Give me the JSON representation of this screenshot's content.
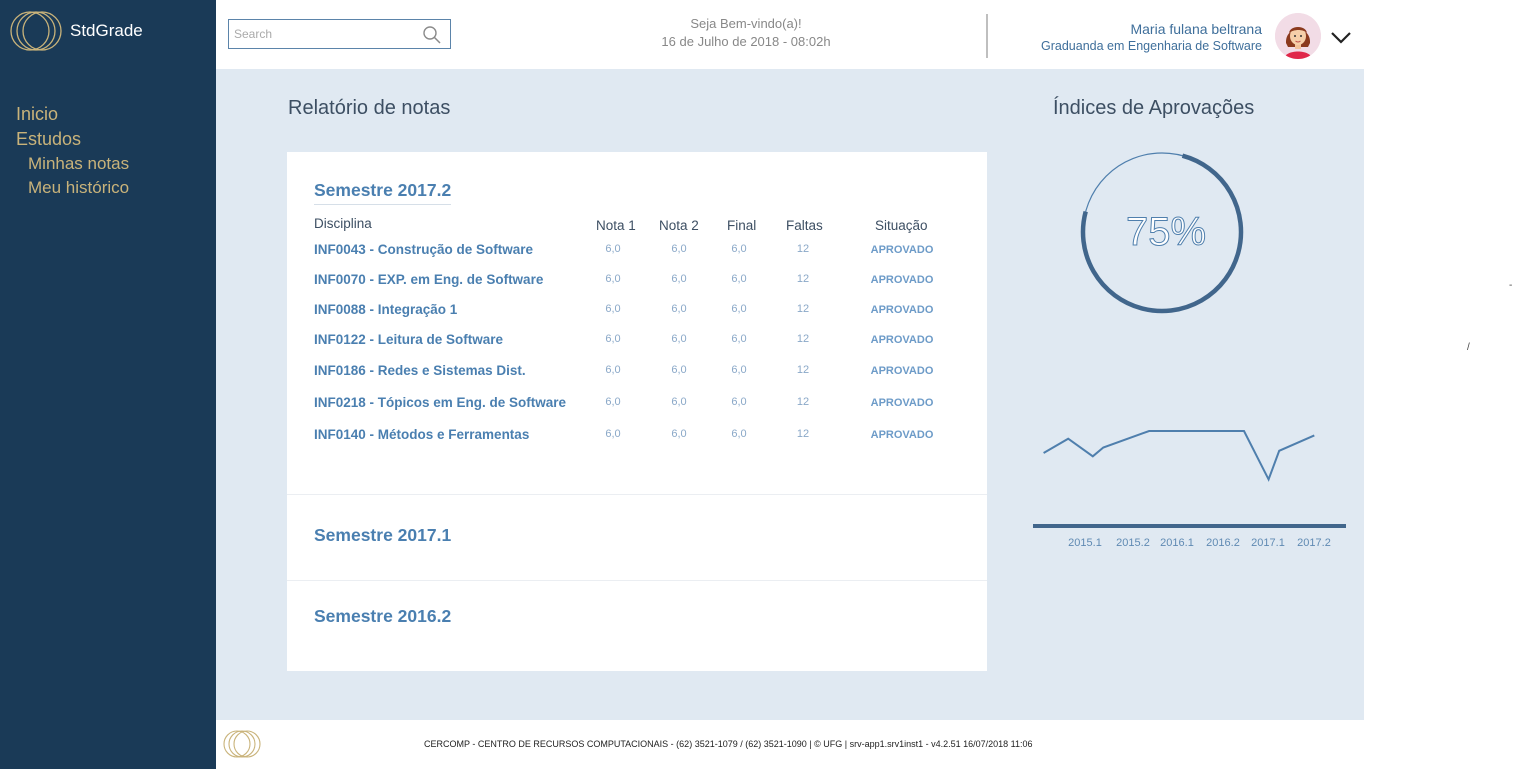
{
  "app": {
    "name": "StdGrade"
  },
  "sidebar": {
    "items": [
      {
        "label": "Inicio"
      },
      {
        "label": "Estudos"
      },
      {
        "label": "Minhas notas"
      },
      {
        "label": "Meu histórico"
      }
    ]
  },
  "header": {
    "search_placeholder": "Search",
    "welcome": "Seja Bem-vindo(a)!",
    "datetime": "16 de Julho de 2018 - 08:02h",
    "user_name": "Maria fulana beltrana",
    "user_role": "Graduanda em Engenharia de Software"
  },
  "report": {
    "title": "Relatório de notas",
    "open_semester": "Semestre 2017.2",
    "columns": {
      "disciplina": "Disciplina",
      "nota1": "Nota 1",
      "nota2": "Nota 2",
      "final": "Final",
      "faltas": "Faltas",
      "situacao": "Situação"
    },
    "rows": [
      {
        "disciplina": "INF0043 - Construção de Software",
        "nota1": "6,0",
        "nota2": "6,0",
        "final": "6,0",
        "faltas": "12",
        "situacao": "APROVADO"
      },
      {
        "disciplina": "INF0070 - EXP. em Eng. de Software",
        "nota1": "6,0",
        "nota2": "6,0",
        "final": "6,0",
        "faltas": "12",
        "situacao": "APROVADO"
      },
      {
        "disciplina": "INF0088 - Integração 1",
        "nota1": "6,0",
        "nota2": "6,0",
        "final": "6,0",
        "faltas": "12",
        "situacao": "APROVADO"
      },
      {
        "disciplina": "INF0122 - Leitura de Software",
        "nota1": "6,0",
        "nota2": "6,0",
        "final": "6,0",
        "faltas": "12",
        "situacao": "APROVADO"
      },
      {
        "disciplina": "INF0186 - Redes e Sistemas Dist.",
        "nota1": "6,0",
        "nota2": "6,0",
        "final": "6,0",
        "faltas": "12",
        "situacao": "APROVADO"
      },
      {
        "disciplina": "INF0218 - Tópicos em Eng. de Software",
        "nota1": "6,0",
        "nota2": "6,0",
        "final": "6,0",
        "faltas": "12",
        "situacao": "APROVADO"
      },
      {
        "disciplina": "INF0140 - Métodos e Ferramentas",
        "nota1": "6,0",
        "nota2": "6,0",
        "final": "6,0",
        "faltas": "12",
        "situacao": "APROVADO"
      }
    ],
    "collapsed_semesters": [
      "Semestre 2017.1",
      "Semestre 2016.2"
    ]
  },
  "indices": {
    "title": "Índices de Aprovações",
    "percent_label": "75%",
    "percent_value": 0.75
  },
  "chart_data": {
    "type": "line",
    "categories": [
      "2015.1",
      "2015.2",
      "2016.1",
      "2016.2",
      "2017.1",
      "2017.2"
    ],
    "x": [
      0.3,
      1,
      1.7,
      2,
      3.3,
      4,
      5,
      6,
      6.7,
      7,
      8
    ],
    "values": [
      60,
      73,
      57,
      65,
      80,
      80,
      80,
      80,
      36,
      62,
      76
    ],
    "xlabel": "",
    "ylabel": "",
    "ylim": [
      0,
      100
    ],
    "xlim": [
      0,
      8.9
    ],
    "color": "#4f7fad",
    "grid": false,
    "legend": "none"
  },
  "footer": {
    "text": "CERCOMP - CENTRO DE RECURSOS COMPUTACIONAIS - (62) 3521-1079 / (62) 3521-1090 | © UFG | srv-app1.srv1inst1 - v4.2.51 16/07/2018 11:06"
  },
  "colors": {
    "sidebar_bg": "#1a3a57",
    "nav_text": "#c9b37a",
    "accent": "#4a7fb0",
    "main_bg": "#e0e9f2"
  }
}
